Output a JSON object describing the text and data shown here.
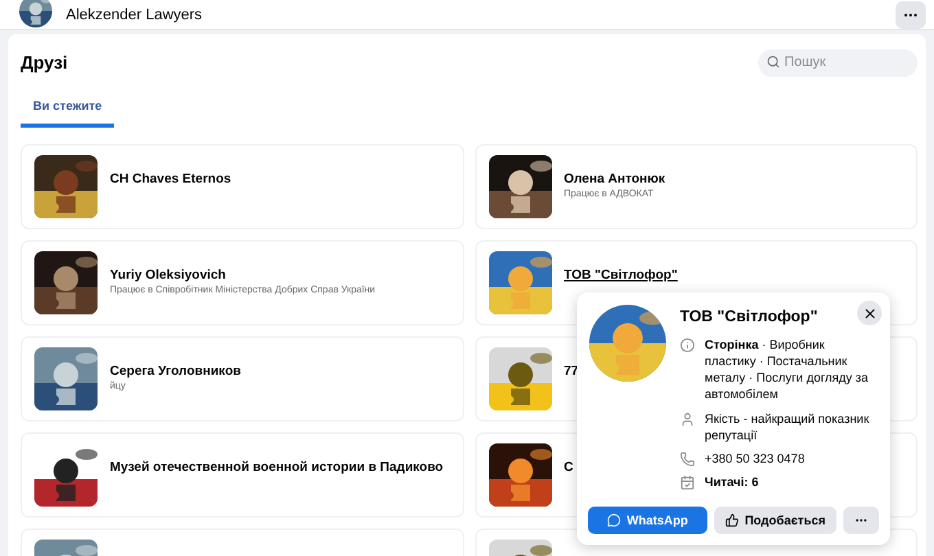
{
  "header": {
    "name": "Alekzender Lawyers"
  },
  "friends": {
    "title": "Друзі",
    "search": {
      "placeholder": "Пошук"
    },
    "tabs": [
      {
        "label": "Ви стежите",
        "selected": true
      }
    ],
    "items": [
      {
        "name": "CH Chaves Eternos",
        "underlined": false
      },
      {
        "name": "Олена Антонюк",
        "subtitle": "Працює в АДВОКАТ",
        "underlined": false
      },
      {
        "name": "Yuriy Oleksiyovich",
        "subtitle": "Працює в Співробітник Міністерства Добрих Справ України",
        "underlined": false
      },
      {
        "name": "ТОВ \"Світлофор\"",
        "underlined": true
      },
      {
        "name": "Серега Уголовников",
        "subtitle": "йцу",
        "underlined": false
      },
      {
        "name": "77",
        "underlined": false
      },
      {
        "name": "Музей отечественной военной истории в Падиково",
        "underlined": false
      },
      {
        "name": "С",
        "underlined": false
      }
    ]
  },
  "popup": {
    "title": "ТОВ \"Світлофор\"",
    "details": [
      {
        "kind": "info",
        "text": "**Сторінка** · Виробник пластику · Постачальник металу · Послуги догляду за автомобілем"
      },
      {
        "kind": "person",
        "text": "Якість - найкращий показник репутації"
      },
      {
        "kind": "phone",
        "text": "+380 50 323 0478"
      },
      {
        "kind": "followers",
        "text": "**Читачі: 6**"
      }
    ],
    "buttons": [
      {
        "kind": "whatsapp",
        "label": "WhatsApp"
      },
      {
        "kind": "like",
        "label": "Подобається"
      },
      {
        "kind": "more"
      }
    ]
  }
}
